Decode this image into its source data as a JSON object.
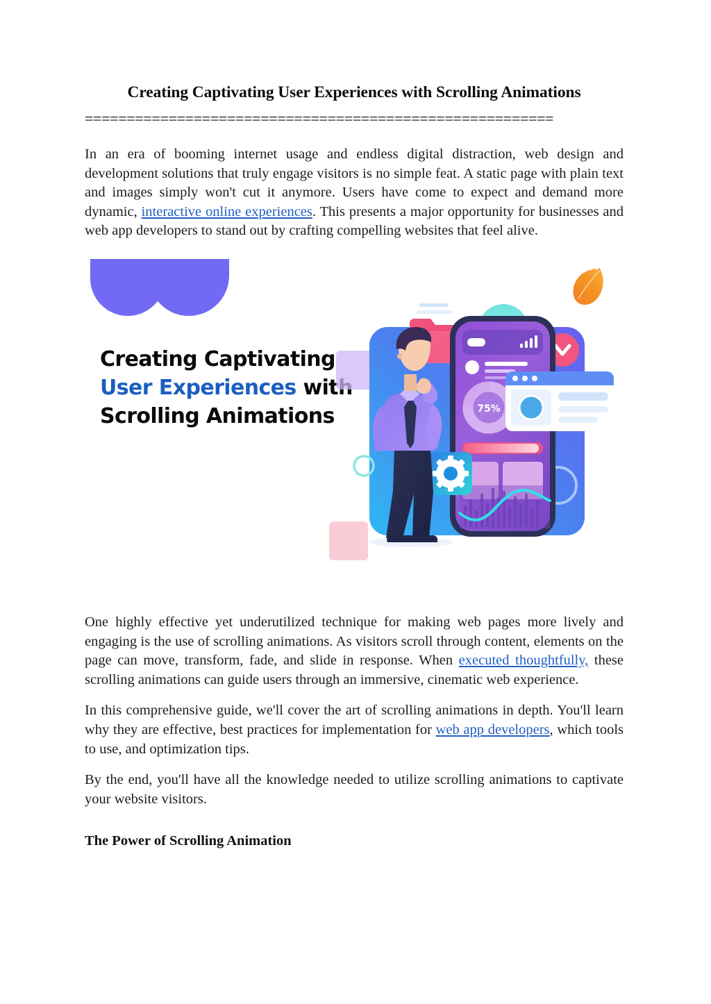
{
  "document": {
    "title": "Creating Captivating User Experiences with Scrolling Animations",
    "divider": "========================================================",
    "paragraphs": {
      "p1_a": "In an era of booming internet usage and endless digital distraction, web design and development solutions that truly engage visitors is no simple feat. A static page with plain text and images simply won't cut it anymore. Users have come to expect and demand more dynamic, ",
      "p1_link": "interactive online experiences",
      "p1_b": ". This presents a major opportunity for businesses and web app developers to stand out by crafting compelling websites that feel alive.",
      "p2_a": "One highly effective yet underutilized technique for making web pages more lively and engaging is the use of scrolling animations. As visitors scroll through content, elements on the page can move, transform, fade, and slide in response. When ",
      "p2_link": "executed thoughtfully,",
      "p2_b": " these scrolling animations can guide users through an immersive, cinematic web experience.",
      "p3_a": "In this comprehensive guide, we'll cover the art of scrolling animations in depth. You'll learn why they are effective, best practices for implementation for ",
      "p3_link": "web app developers",
      "p3_b": ", which tools to use, and optimization tips.",
      "p4": "By the end, you'll have all the knowledge needed to utilize scrolling animations to captivate your website visitors."
    },
    "section_heading": "The Power of Scrolling Animation"
  },
  "illustration": {
    "headline_line1": "Creating Captivating",
    "headline_blue": "User Experiences",
    "headline_line2_rest": " with",
    "headline_line3": "Scrolling Animations",
    "progress_label": "75%",
    "icons": {
      "leaf": "leaf-icon",
      "folder": "folder-icon",
      "gear": "gear-icon",
      "chevron_down": "chevron-down-icon",
      "signal_bars": "signal-bars-icon"
    },
    "colors": {
      "blob_purple": "#7269f5",
      "headline_blue": "#1b5fbf",
      "link_blue": "#1f5fc0",
      "card_blue": "#4f7df0",
      "card_cyan": "#35b4f0",
      "phone_purple": "#8a55d8",
      "phone_pink": "#e07ed4",
      "accent_pink": "#f2557f",
      "leaf_orange": "#f3921f",
      "gear_blue": "#1e8fe0",
      "wave_cyan": "#2fe0e8"
    }
  }
}
